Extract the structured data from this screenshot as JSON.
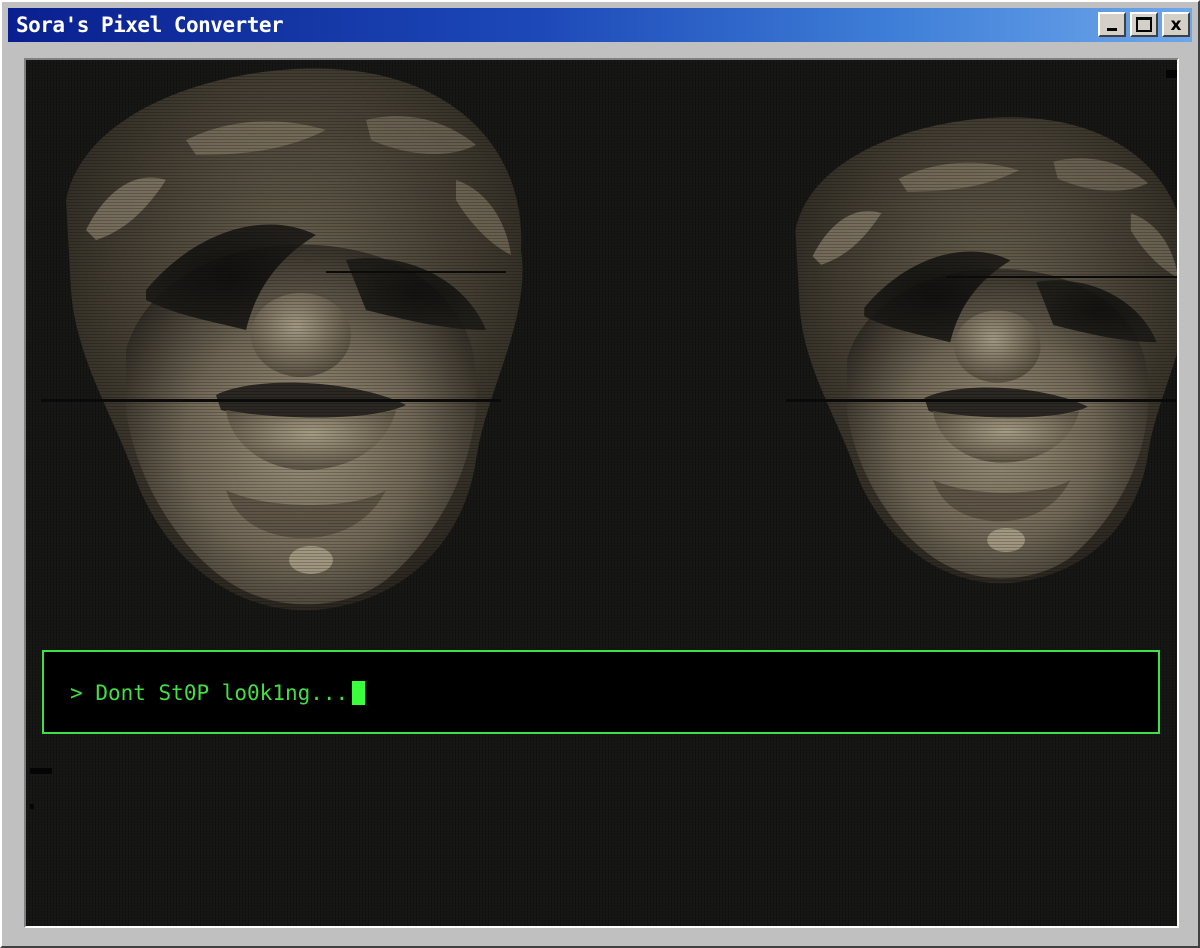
{
  "window": {
    "title": "Sora's Pixel Converter",
    "controls": {
      "minimize": "_",
      "close": "x"
    }
  },
  "terminal": {
    "prompt_symbol": ">",
    "message": "Dont St0P lo0k1ng..."
  },
  "colors": {
    "terminal_text": "#44dd44",
    "terminal_border": "#3ee04a",
    "cursor": "#39ff3c",
    "titlebar_start": "#0a1f8f",
    "titlebar_end": "#6ea6ea"
  },
  "icons": {
    "minimize": "minimize-icon",
    "maximize": "maximize-icon",
    "close": "close-icon"
  }
}
